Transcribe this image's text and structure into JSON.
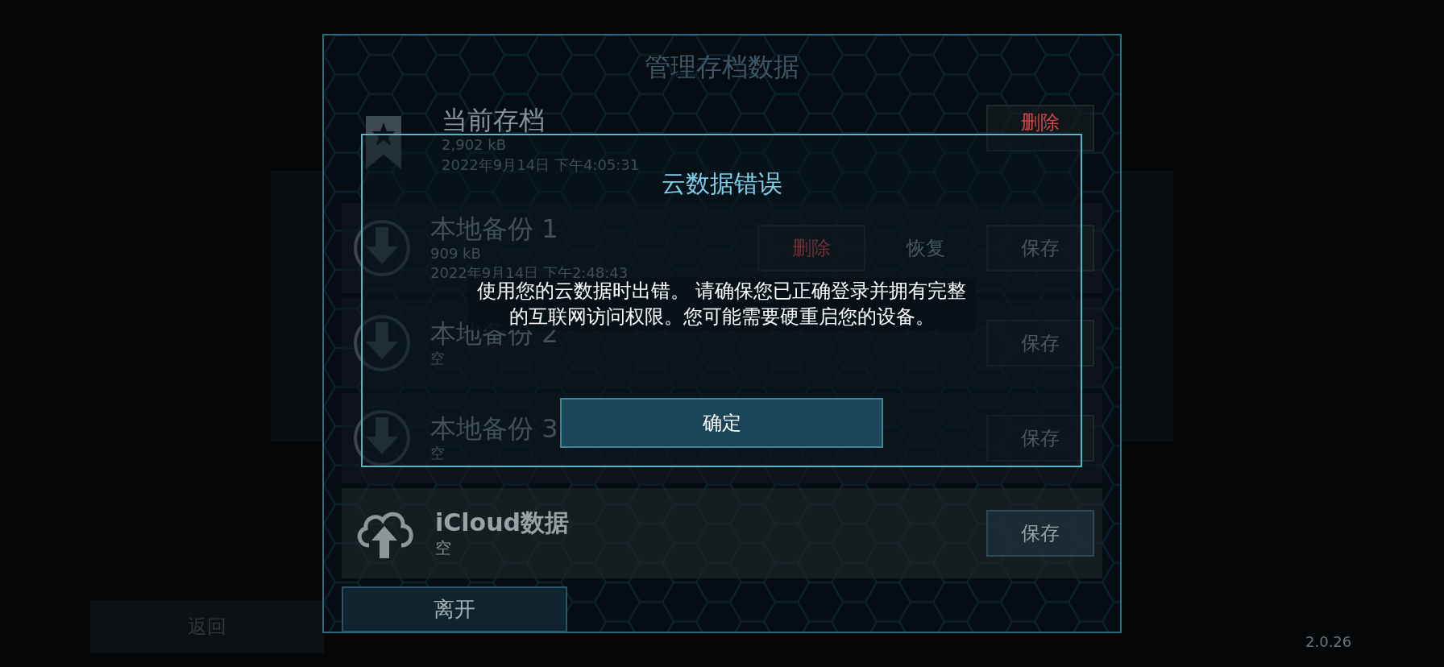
{
  "screen": {
    "back_button": "返回",
    "version": "2.0.26"
  },
  "panel": {
    "title": "管理存档数据",
    "saves": [
      {
        "kind": "current",
        "name": "当前存档",
        "size": "2,902 kB",
        "date": "2022年9月14日 下午4:05:31",
        "actions": [
          {
            "kind": "delete",
            "label": "删除"
          }
        ]
      },
      {
        "kind": "local",
        "name": "本地备份 1",
        "size": "909 kB",
        "date": "2022年9月14日 下午2:48:43",
        "actions": [
          {
            "kind": "delete",
            "label": "删除"
          },
          {
            "kind": "restore",
            "label": "恢复"
          },
          {
            "kind": "save",
            "label": "保存"
          }
        ]
      },
      {
        "kind": "local",
        "name": "本地备份 2",
        "status": "空",
        "actions": [
          {
            "kind": "save",
            "label": "保存"
          }
        ]
      },
      {
        "kind": "local",
        "name": "本地备份 3",
        "status": "空",
        "actions": [
          {
            "kind": "save",
            "label": "保存"
          }
        ]
      },
      {
        "kind": "cloud",
        "name": "iCloud数据",
        "status": "空",
        "actions": [
          {
            "kind": "save",
            "label": "保存"
          }
        ]
      }
    ],
    "exit_button": "离开"
  },
  "dialog": {
    "title": "云数据错误",
    "message": "使用您的云数据时出错。 请确保您已正确登录并拥有完整的互联网访问权限。您可能需要硬重启您的设备。",
    "ok_button": "确定"
  }
}
